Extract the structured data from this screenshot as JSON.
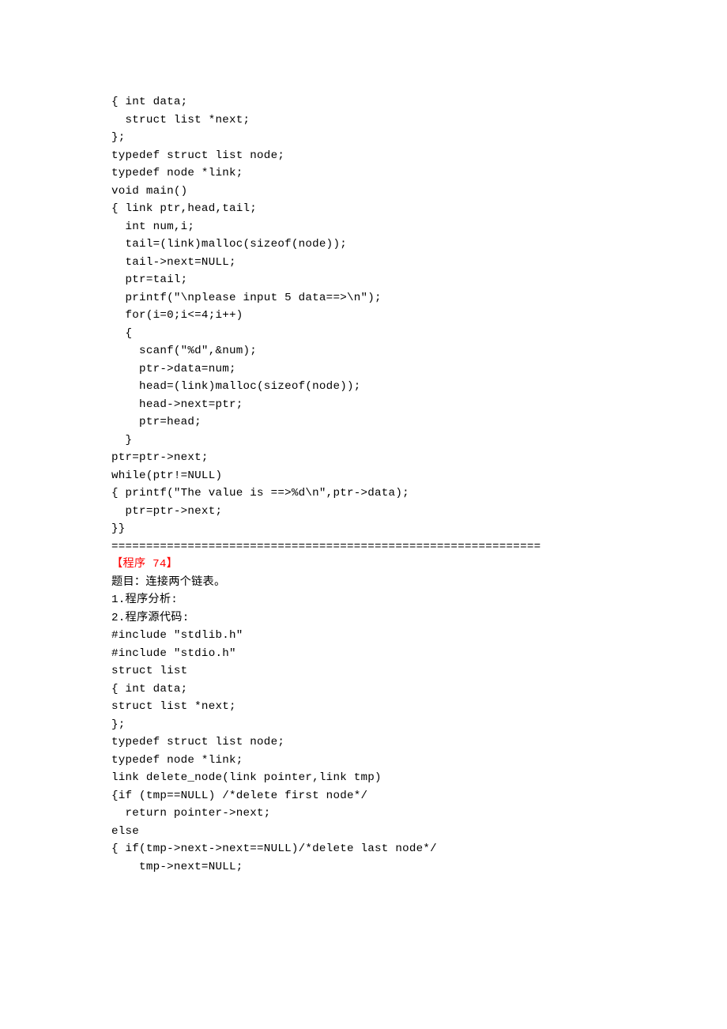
{
  "lines": [
    {
      "text": "{ int data;",
      "red": false
    },
    {
      "text": "  struct list *next;",
      "red": false
    },
    {
      "text": "};",
      "red": false
    },
    {
      "text": "typedef struct list node;",
      "red": false
    },
    {
      "text": "typedef node *link;",
      "red": false
    },
    {
      "text": "void main()",
      "red": false
    },
    {
      "text": "{ link ptr,head,tail;",
      "red": false
    },
    {
      "text": "  int num,i;",
      "red": false
    },
    {
      "text": "  tail=(link)malloc(sizeof(node));",
      "red": false
    },
    {
      "text": "  tail->next=NULL;",
      "red": false
    },
    {
      "text": "  ptr=tail;",
      "red": false
    },
    {
      "text": "  printf(\"\\nplease input 5 data==>\\n\");",
      "red": false
    },
    {
      "text": "  for(i=0;i<=4;i++)",
      "red": false
    },
    {
      "text": "  {",
      "red": false
    },
    {
      "text": "    scanf(\"%d\",&num);",
      "red": false
    },
    {
      "text": "    ptr->data=num;",
      "red": false
    },
    {
      "text": "    head=(link)malloc(sizeof(node));",
      "red": false
    },
    {
      "text": "    head->next=ptr;",
      "red": false
    },
    {
      "text": "    ptr=head;",
      "red": false
    },
    {
      "text": "  }",
      "red": false
    },
    {
      "text": "ptr=ptr->next;",
      "red": false
    },
    {
      "text": "while(ptr!=NULL)",
      "red": false
    },
    {
      "text": "{ printf(\"The value is ==>%d\\n\",ptr->data);",
      "red": false
    },
    {
      "text": "  ptr=ptr->next;",
      "red": false
    },
    {
      "text": "}}",
      "red": false
    },
    {
      "text": "==============================================================",
      "red": false
    },
    {
      "text": "【程序 74】",
      "red": true
    },
    {
      "text": "题目：连接两个链表。",
      "red": false
    },
    {
      "text": "1.程序分析:",
      "red": false
    },
    {
      "text": "2.程序源代码:",
      "red": false
    },
    {
      "text": "#include \"stdlib.h\"",
      "red": false
    },
    {
      "text": "#include \"stdio.h\"",
      "red": false
    },
    {
      "text": "struct list",
      "red": false
    },
    {
      "text": "{ int data;",
      "red": false
    },
    {
      "text": "struct list *next;",
      "red": false
    },
    {
      "text": "};",
      "red": false
    },
    {
      "text": "typedef struct list node;",
      "red": false
    },
    {
      "text": "typedef node *link;",
      "red": false
    },
    {
      "text": "link delete_node(link pointer,link tmp)",
      "red": false
    },
    {
      "text": "{if (tmp==NULL) /*delete first node*/",
      "red": false
    },
    {
      "text": "  return pointer->next;",
      "red": false
    },
    {
      "text": "else",
      "red": false
    },
    {
      "text": "{ if(tmp->next->next==NULL)/*delete last node*/",
      "red": false
    },
    {
      "text": "    tmp->next=NULL;",
      "red": false
    }
  ]
}
